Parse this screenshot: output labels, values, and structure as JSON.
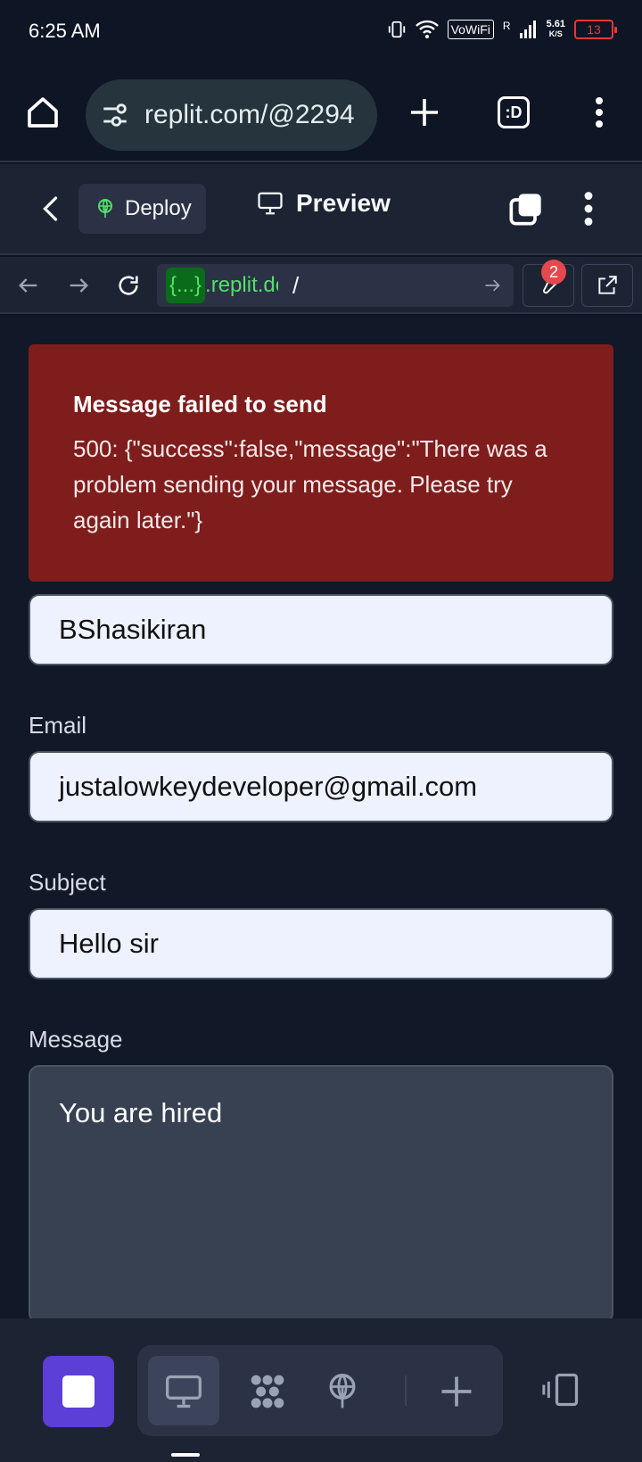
{
  "status_bar": {
    "time": "6:25 AM",
    "vowifi": "VoWiFi",
    "signal_label": "R",
    "speed_value": "5.61",
    "speed_unit": "K/S",
    "battery": "13"
  },
  "browser": {
    "url": "replit.com/@2294",
    "tab_count": ":D"
  },
  "replit_header": {
    "deploy_label": "Deploy",
    "preview_label": "Preview"
  },
  "webview_nav": {
    "url_tag": "{...}",
    "url_host": ".replit.dev",
    "url_path": "/",
    "tools_badge": "2"
  },
  "error": {
    "title": "Message failed to send",
    "body": "500: {\"success\":false,\"message\":\"There was a problem sending your message. Please try again later.\"}"
  },
  "form": {
    "name_value": "BShasikiran",
    "email_label": "Email",
    "email_value": "justalowkeydeveloper@gmail.com",
    "subject_label": "Subject",
    "subject_value": "Hello sir",
    "message_label": "Message",
    "message_value": "You are hired"
  },
  "colors": {
    "error_bg": "#7f1d1d",
    "accent_purple": "#5b3fd6",
    "url_green": "#53e06a"
  },
  "icons": [
    "home-icon",
    "tune-icon",
    "plus-icon",
    "more-vert-icon",
    "back-icon",
    "deploy-icon",
    "monitor-icon",
    "stop-icon",
    "workflow-icon",
    "plus-icon",
    "devices-icon"
  ]
}
